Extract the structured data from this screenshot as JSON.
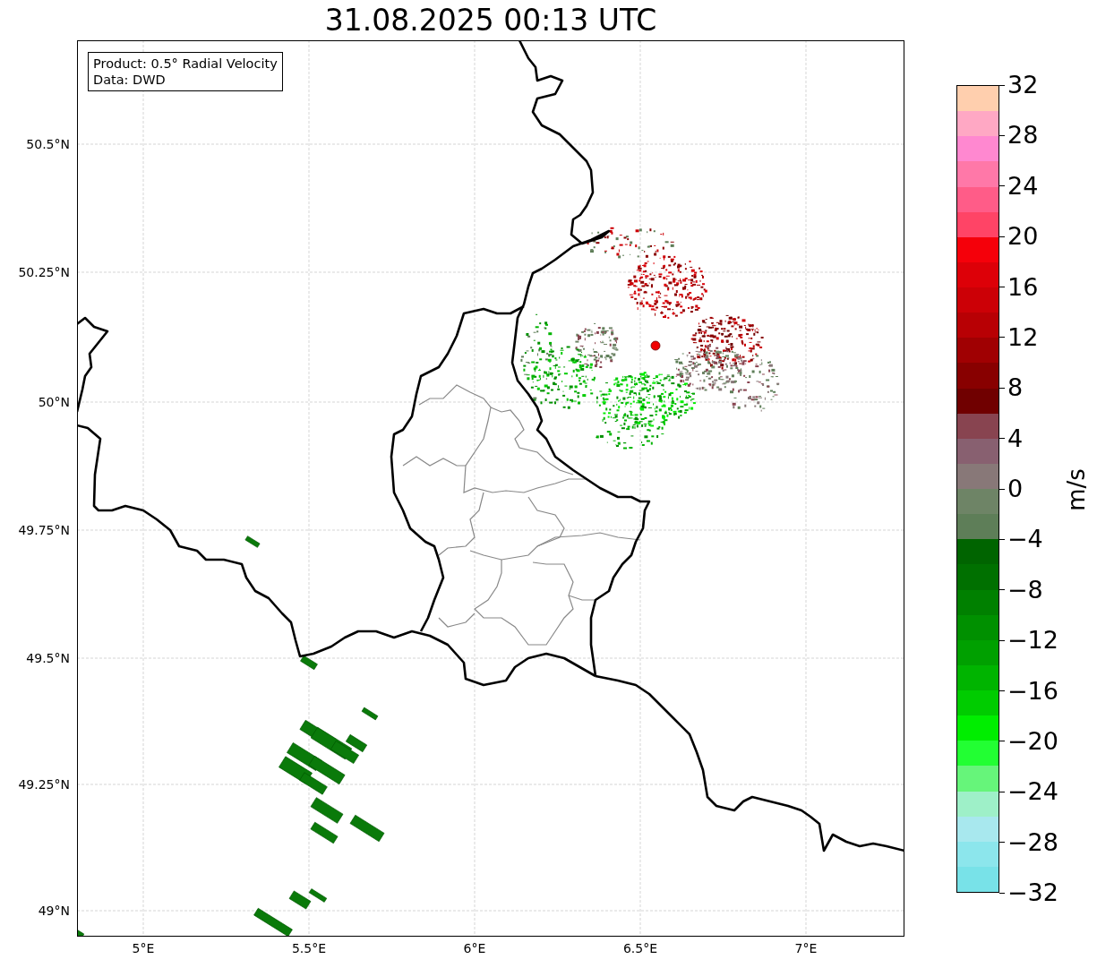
{
  "title": "31.08.2025 00:13 UTC",
  "map": {
    "legend": [
      "Product: 0.5° Radial Velocity",
      "Data: DWD"
    ],
    "latitude_labels": [
      "50.5°N",
      "50.25°N",
      "50°N",
      "49.75°N",
      "49.5°N",
      "49.25°N",
      "49°N"
    ],
    "longitude_labels": [
      "5°E",
      "5.5°E",
      "6°E",
      "6.5°E",
      "7°E"
    ]
  },
  "colorbar": {
    "unit": "m/s",
    "ticks": [
      "32",
      "28",
      "24",
      "20",
      "16",
      "12",
      "8",
      "4",
      "0",
      "−4",
      "−8",
      "−12",
      "−16",
      "−20",
      "−24",
      "−28",
      "−32"
    ],
    "bins": [
      {
        "color": "#ffcfae"
      },
      {
        "color": "#ffa8c4"
      },
      {
        "color": "#ff88d0"
      },
      {
        "color": "#ff78a8"
      },
      {
        "color": "#ff5c88"
      },
      {
        "color": "#ff4466"
      },
      {
        "color": "#f5000a"
      },
      {
        "color": "#dd0008"
      },
      {
        "color": "#cc0006"
      },
      {
        "color": "#b80004"
      },
      {
        "color": "#a00002"
      },
      {
        "color": "#880000"
      },
      {
        "color": "#700000"
      },
      {
        "color": "#884450"
      },
      {
        "color": "#886070"
      },
      {
        "color": "#887878"
      },
      {
        "color": "#6e8466"
      },
      {
        "color": "#5e7e58"
      },
      {
        "color": "#006400"
      },
      {
        "color": "#007000"
      },
      {
        "color": "#008000"
      },
      {
        "color": "#009000"
      },
      {
        "color": "#00a000"
      },
      {
        "color": "#00b400"
      },
      {
        "color": "#00cc00"
      },
      {
        "color": "#00ee00"
      },
      {
        "color": "#22ff33"
      },
      {
        "color": "#66f57a"
      },
      {
        "color": "#9ef0c8"
      },
      {
        "color": "#a8e8ee"
      },
      {
        "color": "#8ce6ec"
      },
      {
        "color": "#78e2e8"
      }
    ]
  }
}
